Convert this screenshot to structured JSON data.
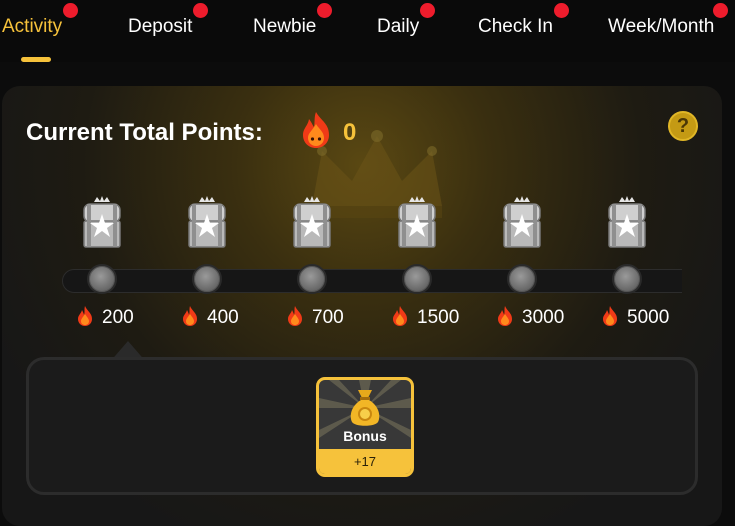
{
  "tabs": [
    {
      "label": "Activity",
      "active": true,
      "has_dot": true
    },
    {
      "label": "Deposit",
      "active": false,
      "has_dot": true
    },
    {
      "label": "Newbie",
      "active": false,
      "has_dot": true
    },
    {
      "label": "Daily",
      "active": false,
      "has_dot": true
    },
    {
      "label": "Check In",
      "active": false,
      "has_dot": true
    },
    {
      "label": "Week/Month",
      "active": false,
      "has_dot": true
    }
  ],
  "panel": {
    "title": "Current Total Points:",
    "points_icon": "fire-icon",
    "points_value": "0",
    "help_label": "?",
    "help_icon": "help-icon"
  },
  "milestones": [
    {
      "points": "200",
      "chest_icon": "silver-chest-icon"
    },
    {
      "points": "400",
      "chest_icon": "silver-chest-icon"
    },
    {
      "points": "700",
      "chest_icon": "silver-chest-icon"
    },
    {
      "points": "1500",
      "chest_icon": "silver-chest-icon"
    },
    {
      "points": "3000",
      "chest_icon": "silver-chest-icon"
    },
    {
      "points": "5000",
      "chest_icon": "silver-chest-icon"
    }
  ],
  "reward": {
    "name": "Bonus",
    "amount": "+17",
    "icon": "money-bag-icon"
  },
  "colors": {
    "accent": "#f6c23b",
    "notification_dot": "#ee1c2c",
    "background": "#0c0c0c"
  }
}
